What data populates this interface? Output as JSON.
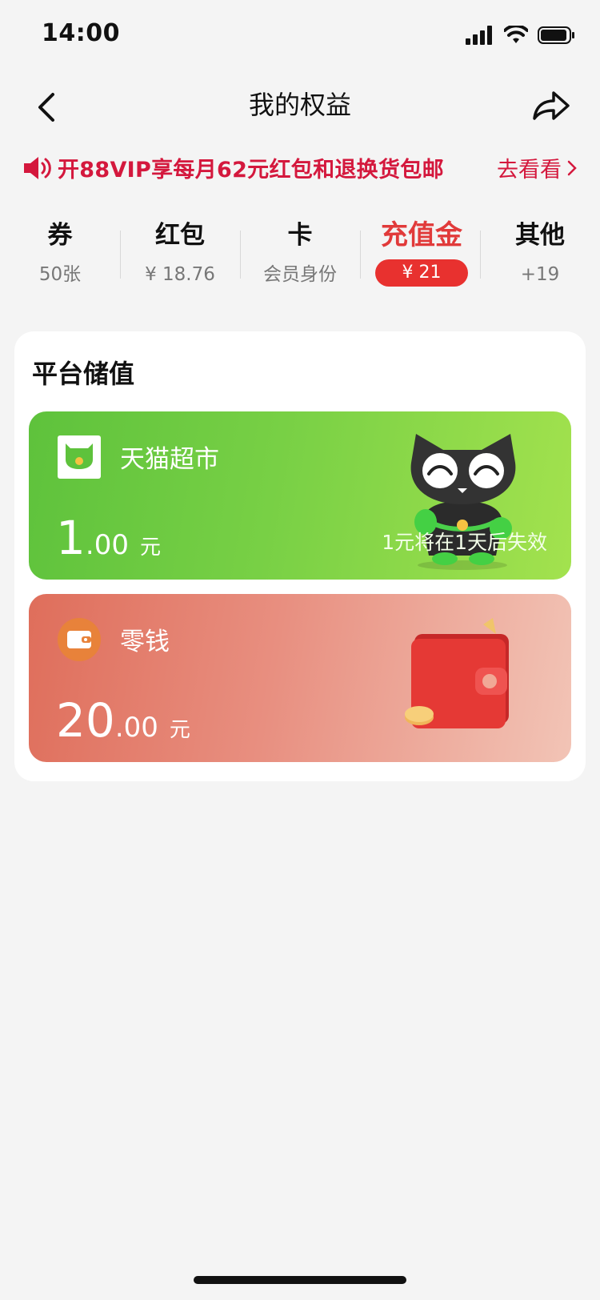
{
  "status_bar": {
    "time": "14:00"
  },
  "nav": {
    "title": "我的权益"
  },
  "promo": {
    "text": "开88VIP享每月62元红包和退换货包邮",
    "link": "去看看",
    "accent": "#d4183d"
  },
  "tabs": [
    {
      "label": "券",
      "sub": "50张",
      "active": false
    },
    {
      "label": "红包",
      "sub": "¥ 18.76",
      "active": false
    },
    {
      "label": "卡",
      "sub": "会员身份",
      "active": false
    },
    {
      "label": "充值金",
      "sub": "¥ 21",
      "active": true
    },
    {
      "label": "其他",
      "sub": "+19",
      "active": false
    }
  ],
  "panel": {
    "title": "平台储值",
    "cards": [
      {
        "name": "天猫超市",
        "amount_int": "1",
        "amount_dec": ".00",
        "unit": "元",
        "note": "1元将在1天后失效",
        "color": "#78d045"
      },
      {
        "name": "零钱",
        "amount_int": "20",
        "amount_dec": ".00",
        "unit": "元",
        "color": "#e88f80"
      }
    ]
  }
}
